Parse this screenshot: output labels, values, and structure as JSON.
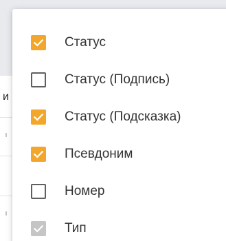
{
  "background": {
    "partial_letter": "и"
  },
  "menu": {
    "items": [
      {
        "label": "Статус",
        "checked": true,
        "disabled": false
      },
      {
        "label": "Статус (Подпись)",
        "checked": false,
        "disabled": false
      },
      {
        "label": "Статус (Подсказка)",
        "checked": true,
        "disabled": false
      },
      {
        "label": "Псевдоним",
        "checked": true,
        "disabled": false
      },
      {
        "label": "Номер",
        "checked": false,
        "disabled": false
      },
      {
        "label": "Тип",
        "checked": true,
        "disabled": true
      }
    ]
  },
  "colors": {
    "checkbox_checked": "#f2a72c",
    "checkbox_disabled": "#c5c5c5",
    "checkbox_border": "#5f5f5f",
    "label_text": "#333333"
  },
  "icons": {
    "checked": "check-icon"
  }
}
